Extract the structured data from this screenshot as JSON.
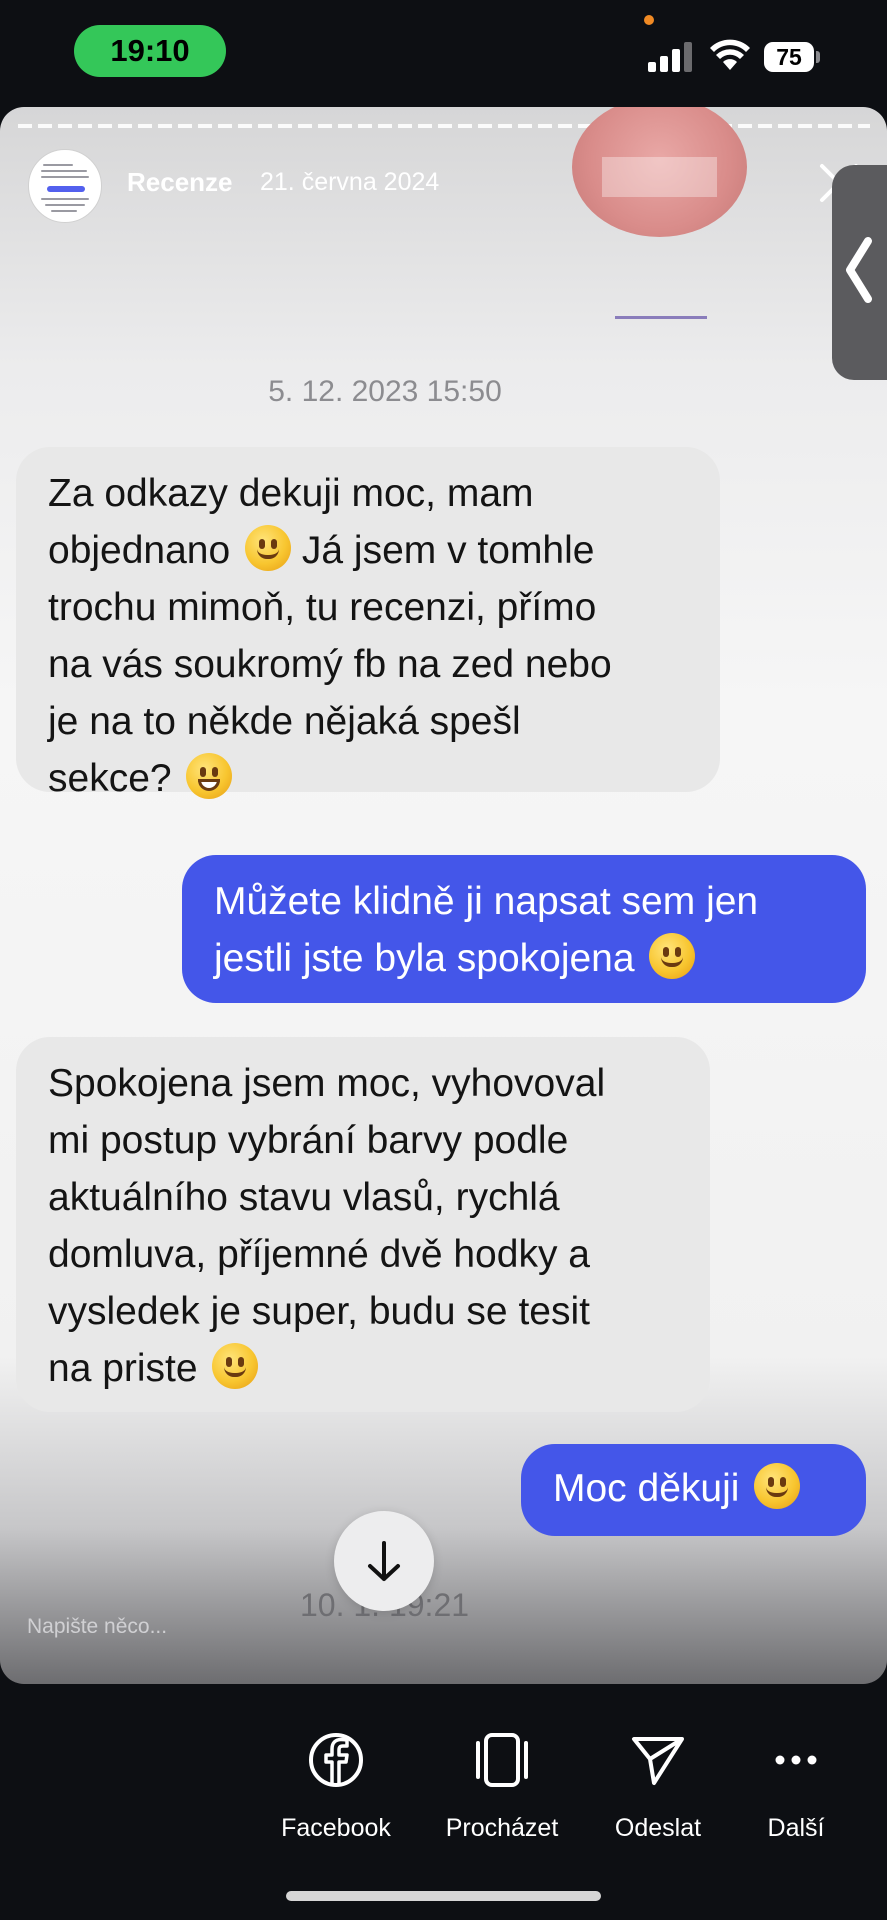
{
  "status_bar": {
    "time": "19:10",
    "battery": "75"
  },
  "story": {
    "username": "Recenze",
    "date": "21. června 2024",
    "reply_placeholder": "Napište něco..."
  },
  "chat": {
    "timestamp_top": "5. 12. 2023 15:50",
    "messages": [
      {
        "side": "in",
        "lines": [
          "Za odkazy dekuji moc, mam",
          "objednano",
          "Já jsem v tomhle",
          "trochu mimoň, tu recenzi, přímo",
          "na vás soukromý fb na zed nebo",
          "je na to někde nějaká spešl",
          "sekce?"
        ]
      },
      {
        "side": "out",
        "lines": [
          "Můžete klidně ji napsat sem jen",
          "jestli jste byla spokojena"
        ]
      },
      {
        "side": "in",
        "lines": [
          "Spokojena jsem moc, vyhovoval",
          "mi postup vybrání barvy podle",
          "aktuálního stavu vlasů, rychlá",
          "domluva, příjemné dvě hodky a",
          "vysledek je super, budu se tesit",
          "na priste"
        ]
      },
      {
        "side": "out",
        "lines": [
          "Moc děkuji"
        ]
      }
    ],
    "timestamp_bottom": "10. 1. 19:21"
  },
  "share_bar": {
    "items": [
      {
        "label": "Facebook",
        "icon": "facebook-icon"
      },
      {
        "label": "Procházet",
        "icon": "browse-icon"
      },
      {
        "label": "Odeslat",
        "icon": "send-icon"
      },
      {
        "label": "Další",
        "icon": "more-icon"
      }
    ]
  }
}
